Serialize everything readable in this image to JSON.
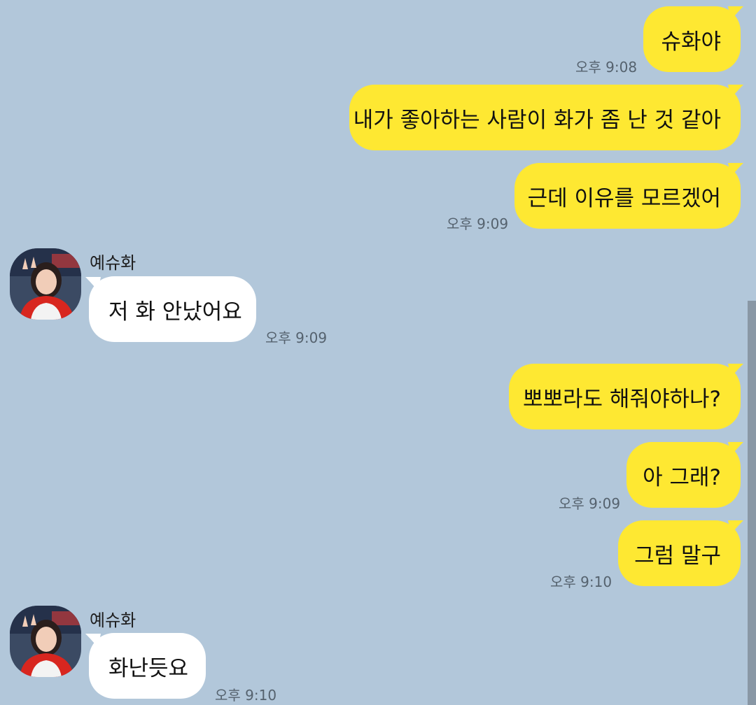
{
  "chat": {
    "messages": [
      {
        "from": "me",
        "text": "슈화야"
      },
      {
        "from": "me",
        "text": "내가 좋아하는 사람이 화가 좀 난 것 같아"
      },
      {
        "from": "me",
        "text": "근데 이유를 모르겠어",
        "time": "오후 9:09"
      },
      {
        "from": "other",
        "sender": "예슈화",
        "text": "저 화 안났어요",
        "time": "오후 9:09"
      },
      {
        "from": "me",
        "text": "뽀뽀라도 해줘야하나?"
      },
      {
        "from": "me",
        "text": "아 그래?",
        "time": "오후 9:09"
      },
      {
        "from": "me",
        "text": "그럼 말구",
        "time": "오후 9:10"
      },
      {
        "from": "other",
        "sender": "예슈화",
        "text": "화난듯요",
        "time": "오후 9:10"
      }
    ],
    "first_time": "오후 9:08"
  },
  "colors": {
    "background": "#b2c7da",
    "my_bubble": "#fee832",
    "their_bubble": "#ffffff"
  },
  "icons": {
    "avatar": "profile-photo"
  }
}
